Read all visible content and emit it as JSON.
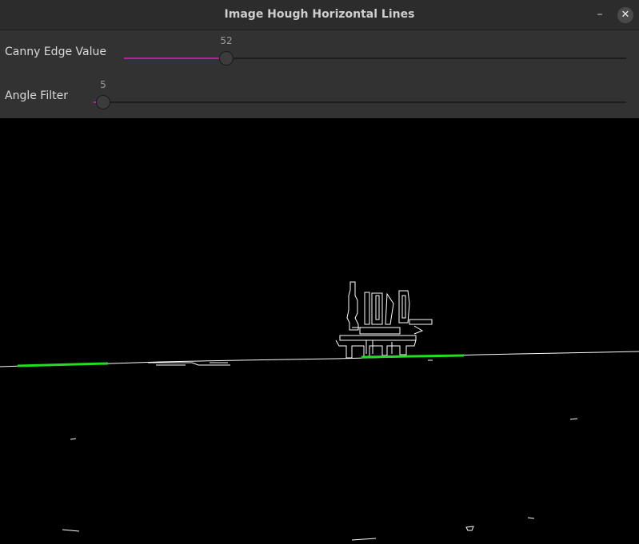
{
  "window": {
    "title": "Image Hough Horizontal Lines",
    "minimize_glyph": "–",
    "close_glyph": "✕"
  },
  "sliders": [
    {
      "label": "Canny Edge Value",
      "value": "52",
      "fraction": 0.2
    },
    {
      "label": "Angle Filter",
      "value": "5",
      "fraction": 0.02
    }
  ],
  "colors": {
    "slider_fill": "#b4259b",
    "detected_line": "#22dd22",
    "edges": "#ffffff"
  },
  "icons": [
    "minimize-icon",
    "close-icon"
  ]
}
